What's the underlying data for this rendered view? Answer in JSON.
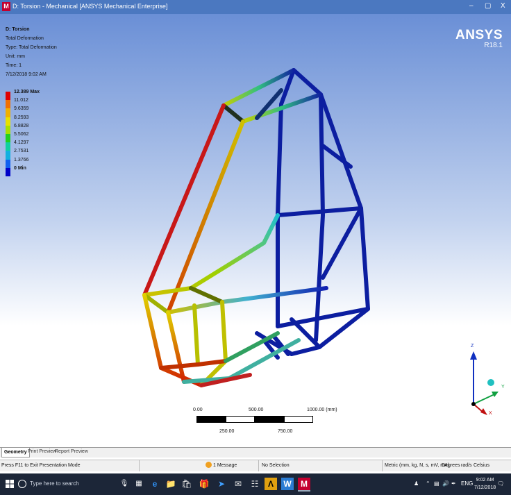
{
  "window": {
    "title": "D: Torsion - Mechanical [ANSYS Mechanical Enterprise]",
    "app_icon_letter": "M",
    "minimize_glyph": "–",
    "maximize_glyph": "▢",
    "close_glyph": "X"
  },
  "result_info": {
    "title": "D: Torsion",
    "result_name": "Total Deformation",
    "type": "Type: Total Deformation",
    "unit": "Unit: mm",
    "time": "Time: 1",
    "date": "7/12/2018 9:02 AM"
  },
  "brand": {
    "name": "ANSYS",
    "version": "R18.1"
  },
  "legend": {
    "entries": [
      {
        "label": "12.389 Max",
        "color": "#e00000",
        "bold": true
      },
      {
        "label": "11.012",
        "color": "#f07000"
      },
      {
        "label": "9.6359",
        "color": "#f0b000"
      },
      {
        "label": "8.2593",
        "color": "#e8e000"
      },
      {
        "label": "6.8828",
        "color": "#a8e000"
      },
      {
        "label": "5.5062",
        "color": "#20d020"
      },
      {
        "label": "4.1297",
        "color": "#10d0a0"
      },
      {
        "label": "2.7531",
        "color": "#10b0e0"
      },
      {
        "label": "1.3766",
        "color": "#1060f0"
      },
      {
        "label": "0 Min",
        "color": "#0000c8",
        "bold": true
      }
    ]
  },
  "scale_bar": {
    "label_0": "0.00",
    "label_500": "500.00",
    "label_1000": "1000.00 (mm)",
    "label_250": "250.00",
    "label_750": "750.00"
  },
  "triad": {
    "z_label": "Z",
    "y_label": "Y",
    "x_label": "X"
  },
  "tabs": [
    {
      "label": "Geometry",
      "active": true
    },
    {
      "label": "Print Preview",
      "active": false
    },
    {
      "label": "Report Preview",
      "active": false
    }
  ],
  "status": {
    "hint": "Press F11 to Exit Presentation Mode",
    "messages": "1 Message",
    "selection": "No Selection",
    "units": "Metric (mm, kg, N, s, mV, mA)",
    "angle": "Degrees",
    "rate": "rad/s",
    "temp": "Celsius"
  },
  "taskbar": {
    "search_placeholder": "Type here to search",
    "lang": "ENG",
    "time": "9:02 AM",
    "date": "7/12/2018"
  },
  "colors": {
    "titlebar": "#4b78c0",
    "frame_low": "#0a1a9a",
    "frame_high": "#d01010"
  }
}
